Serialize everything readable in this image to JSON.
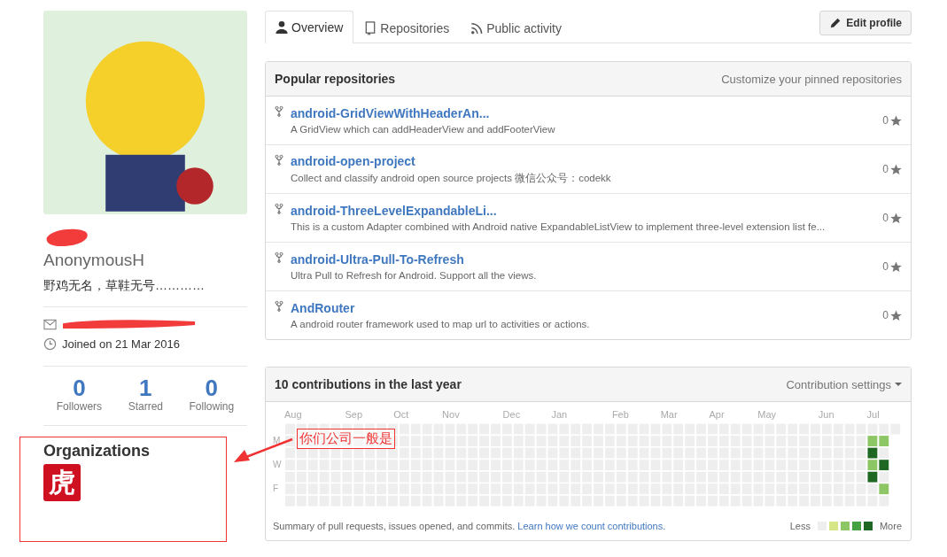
{
  "profile": {
    "username": "AnonymousH",
    "bio": "野鸡无名，草鞋无号…………",
    "joined": "Joined on 21 Mar 2016",
    "stats": [
      {
        "count": "0",
        "label": "Followers"
      },
      {
        "count": "1",
        "label": "Starred"
      },
      {
        "count": "0",
        "label": "Following"
      }
    ],
    "organizations_title": "Organizations",
    "org_logo": "虎"
  },
  "tabs": [
    {
      "label": "Overview",
      "selected": true
    },
    {
      "label": "Repositories",
      "selected": false
    },
    {
      "label": "Public activity",
      "selected": false
    }
  ],
  "edit_button": "Edit profile",
  "popular": {
    "title": "Popular repositories",
    "link": "Customize your pinned repositories",
    "repos": [
      {
        "name": "android-GridViewWithHeaderAn...",
        "description": "A GridView which can addHeaderView and addFooterView",
        "stars": "0"
      },
      {
        "name": "android-open-project",
        "description": "Collect and classify android open source projects 微信公众号：codekk",
        "stars": "0"
      },
      {
        "name": "android-ThreeLevelExpandableLi...",
        "description": "This is a custom Adapter combined with Android native ExpandableListView to implement three-level extension list fe...",
        "stars": "0"
      },
      {
        "name": "android-Ultra-Pull-To-Refresh",
        "description": "Ultra Pull to Refresh for Android. Support all the views.",
        "stars": "0"
      },
      {
        "name": "AndRouter",
        "description": "A android router framework used to map url to activities or actions.",
        "stars": "0"
      }
    ]
  },
  "contributions": {
    "title": "10 contributions in the last year",
    "settings": "Contribution settings",
    "months": [
      "Aug",
      "Sep",
      "Oct",
      "Nov",
      "Dec",
      "Jan",
      "Feb",
      "Mar",
      "Apr",
      "May",
      "Jun",
      "Jul"
    ],
    "day_labels": [
      "M",
      "W",
      "F"
    ],
    "summary": "Summary of pull requests, issues opened, and commits. ",
    "summary_link": "Learn how we count contributions.",
    "less": "Less",
    "more": "More"
  },
  "annotation": {
    "text": "你们公司一般是"
  }
}
